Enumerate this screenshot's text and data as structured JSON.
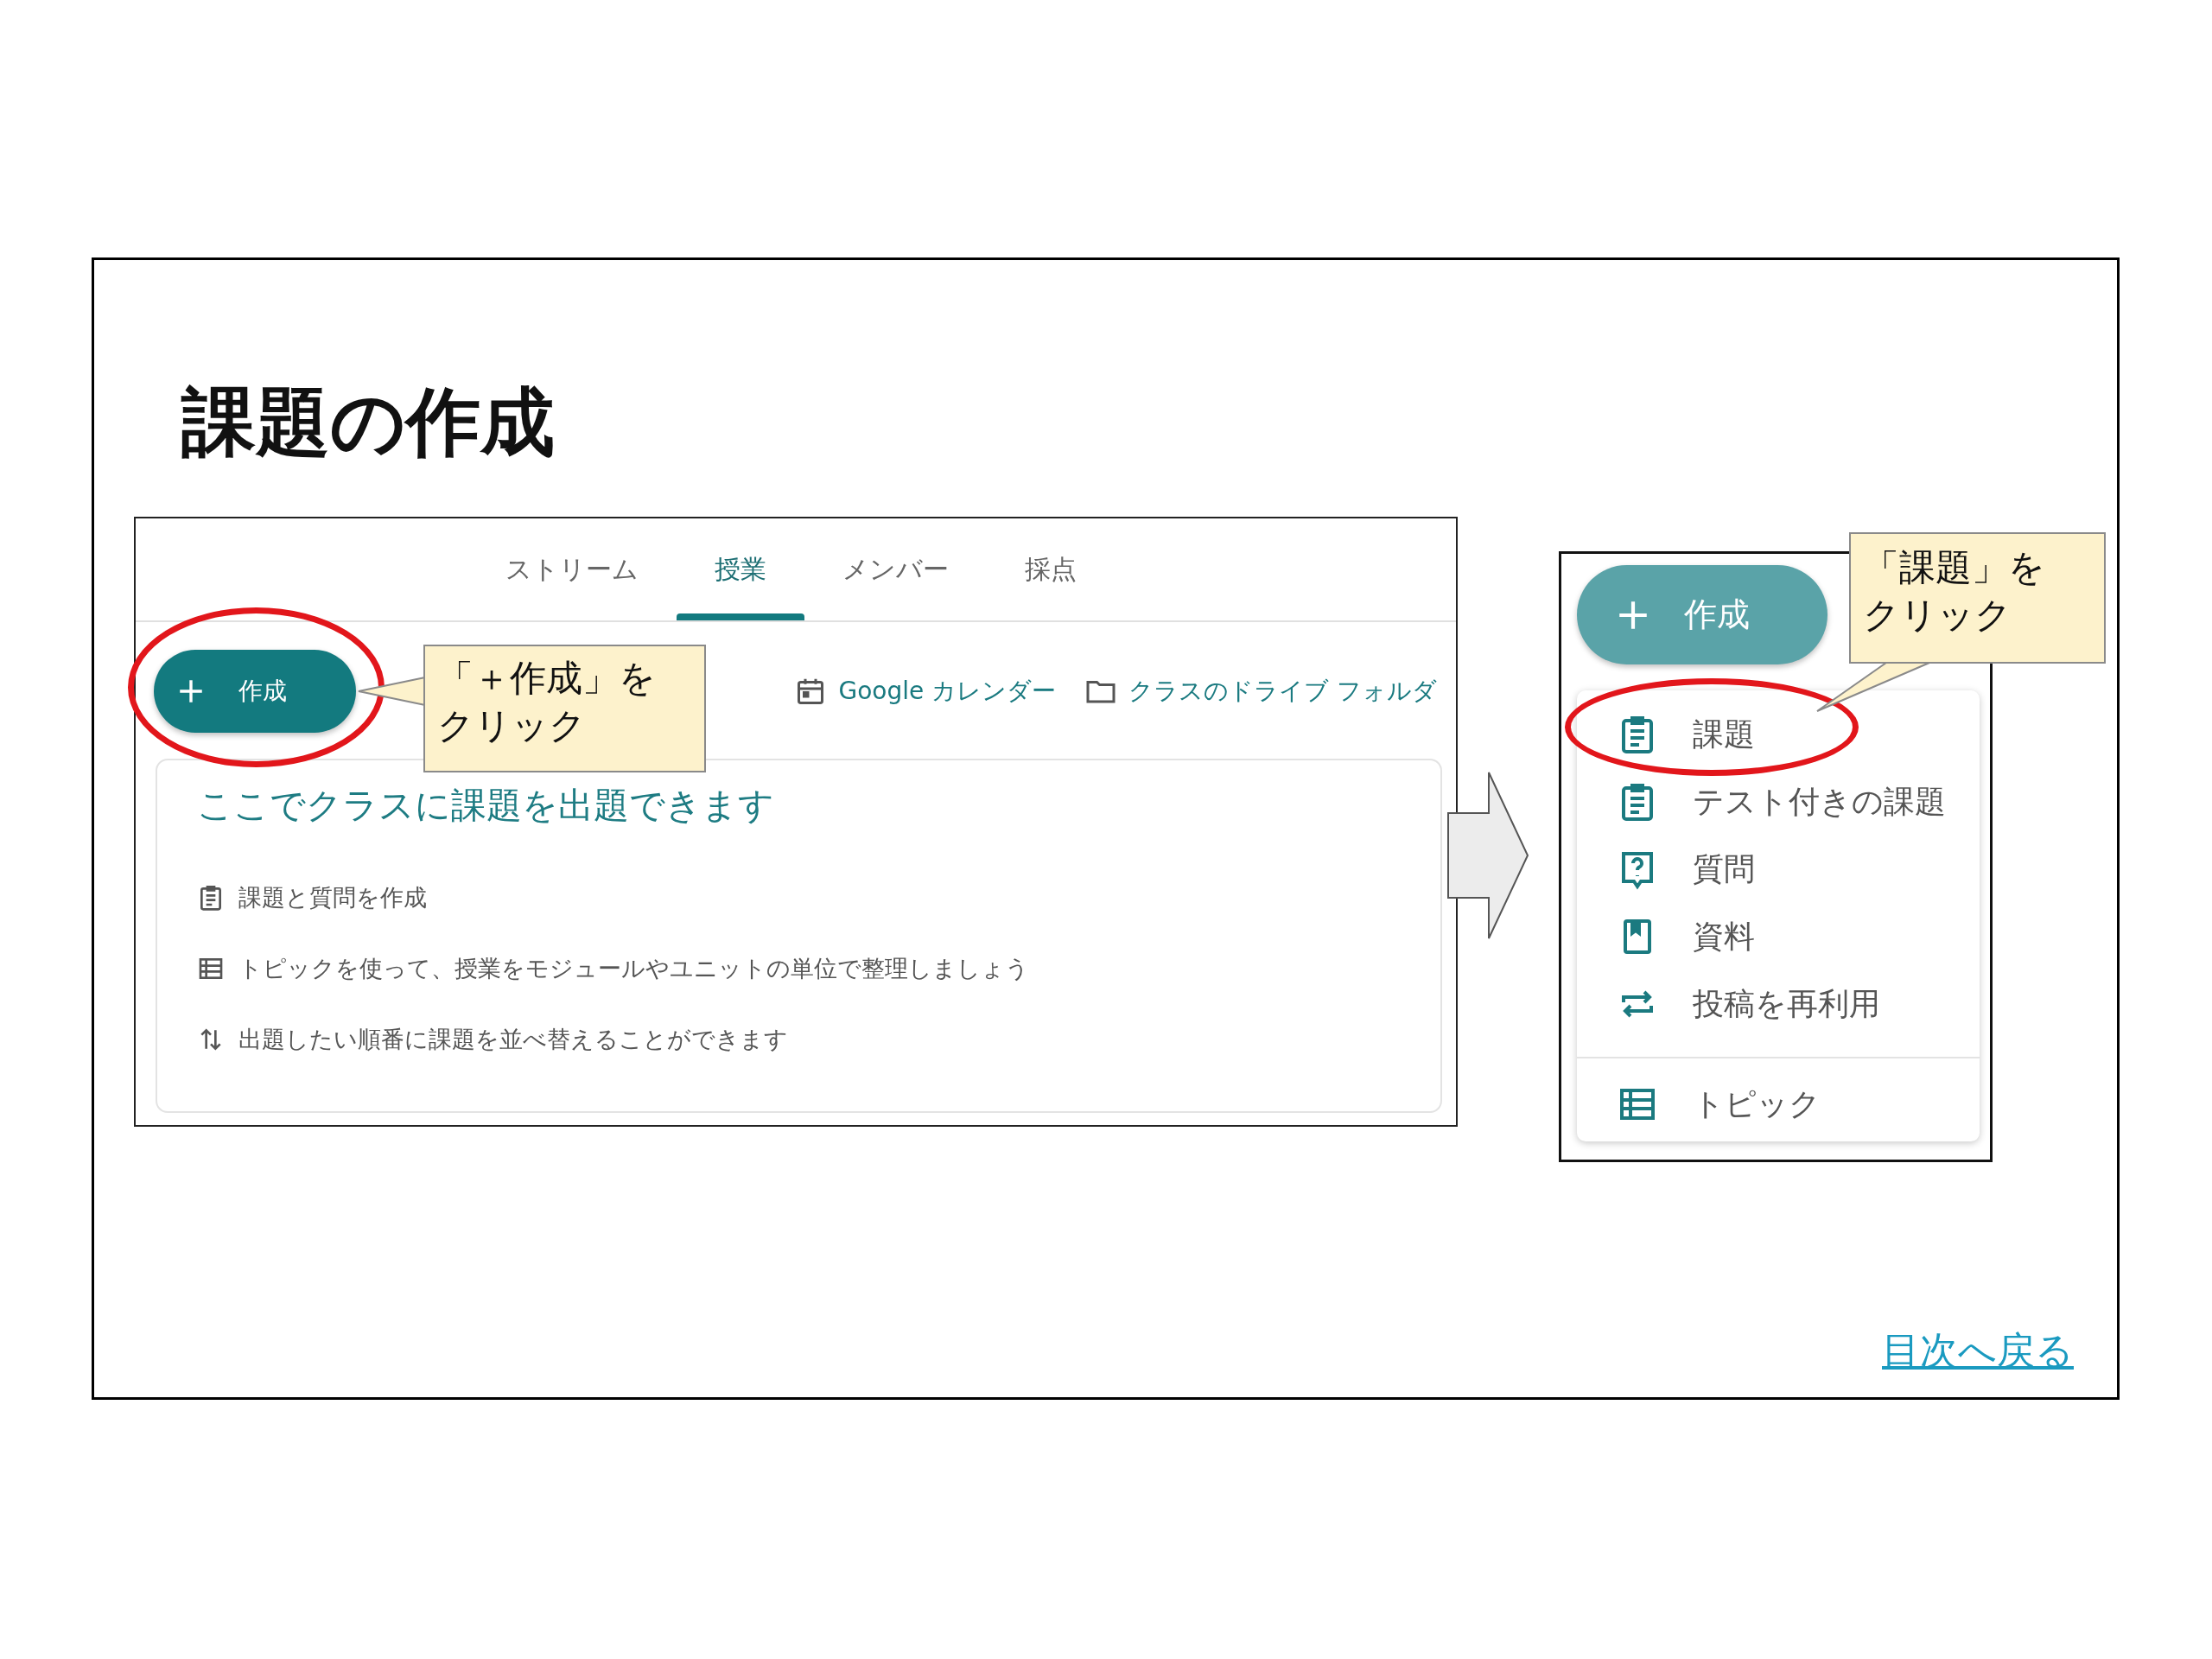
{
  "slide": {
    "title": "課題の作成",
    "back_link": "目次へ戻る"
  },
  "classroom_page": {
    "tabs": [
      {
        "label": "ストリーム",
        "selected": false
      },
      {
        "label": "授業",
        "selected": true
      },
      {
        "label": "メンバー",
        "selected": false
      },
      {
        "label": "採点",
        "selected": false
      }
    ],
    "create_button": {
      "label": "作成",
      "highlighted": true
    },
    "links": [
      {
        "kind": "calendar",
        "label": "Google カレンダー"
      },
      {
        "kind": "folder",
        "label": "クラスのドライブ フォルダ"
      }
    ],
    "empty_state": {
      "heading": "ここでクラスに課題を出題できます",
      "tips": [
        {
          "kind": "assignment",
          "text": "課題と質問を作成"
        },
        {
          "kind": "topic",
          "text": "トピックを使って、授業をモジュールやユニットの単位で整理しましょう"
        },
        {
          "kind": "reorder",
          "text": "出題したい順番に課題を並べ替えることができます"
        }
      ]
    },
    "callout": {
      "lines": [
        "「＋作成」を",
        "クリック"
      ]
    }
  },
  "create_menu": {
    "create_button": {
      "label": "作成"
    },
    "items": [
      {
        "kind": "assignment",
        "label": "課題",
        "highlighted": true
      },
      {
        "kind": "assignment",
        "label": "テスト付きの課題",
        "highlighted": false
      },
      {
        "kind": "question",
        "label": "質問",
        "highlighted": false
      },
      {
        "kind": "material",
        "label": "資料",
        "highlighted": false
      },
      {
        "kind": "reuse",
        "label": "投稿を再利用",
        "highlighted": false
      }
    ],
    "extra_items": [
      {
        "kind": "topic",
        "label": "トピック",
        "highlighted": false
      }
    ],
    "callout": {
      "lines": [
        "「課題」を",
        "クリック"
      ]
    }
  }
}
